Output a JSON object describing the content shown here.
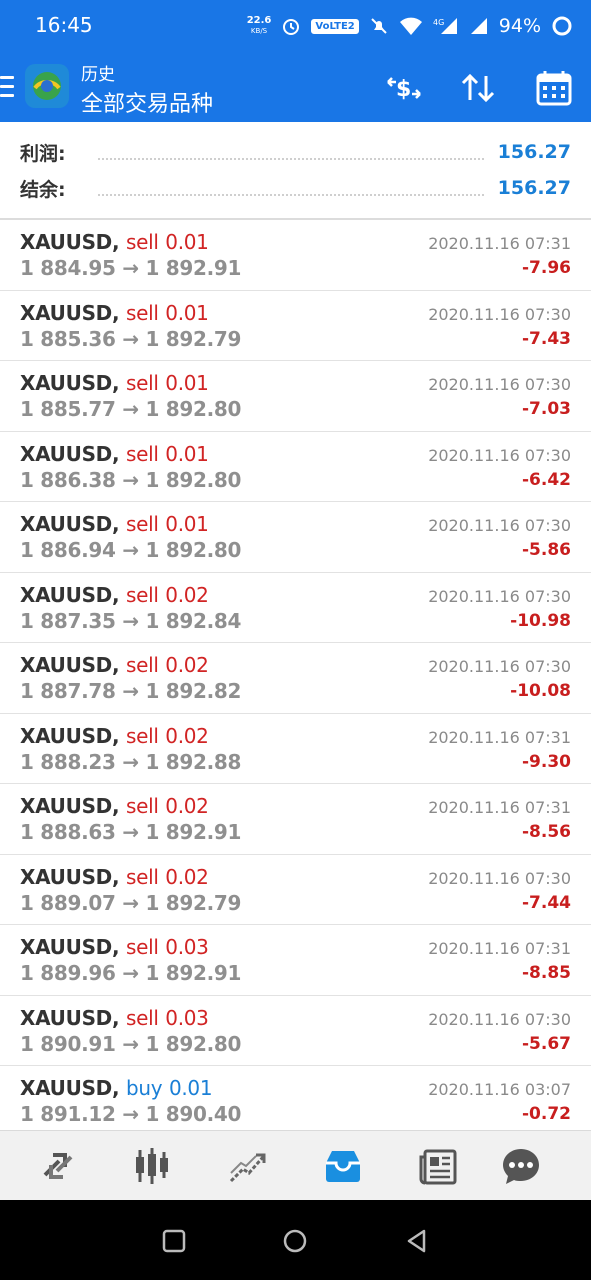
{
  "status_bar": {
    "time": "16:45",
    "net_speed": "22.6",
    "net_unit": "KB/S",
    "volte": "VoLTE2",
    "battery": "94%"
  },
  "toolbar": {
    "subtitle": "历史",
    "title": "全部交易品种"
  },
  "summary": {
    "profit_label": "利润:",
    "profit_value": "156.27",
    "balance_label": "结余:",
    "balance_value": "156.27"
  },
  "trades": [
    {
      "symbol": "XAUUSD,",
      "dir": "sell",
      "lots": "0.01",
      "prices": "1 884.95 → 1 892.91",
      "time": "2020.11.16 07:31",
      "profit": "-7.96"
    },
    {
      "symbol": "XAUUSD,",
      "dir": "sell",
      "lots": "0.01",
      "prices": "1 885.36 → 1 892.79",
      "time": "2020.11.16 07:30",
      "profit": "-7.43"
    },
    {
      "symbol": "XAUUSD,",
      "dir": "sell",
      "lots": "0.01",
      "prices": "1 885.77 → 1 892.80",
      "time": "2020.11.16 07:30",
      "profit": "-7.03"
    },
    {
      "symbol": "XAUUSD,",
      "dir": "sell",
      "lots": "0.01",
      "prices": "1 886.38 → 1 892.80",
      "time": "2020.11.16 07:30",
      "profit": "-6.42"
    },
    {
      "symbol": "XAUUSD,",
      "dir": "sell",
      "lots": "0.01",
      "prices": "1 886.94 → 1 892.80",
      "time": "2020.11.16 07:30",
      "profit": "-5.86"
    },
    {
      "symbol": "XAUUSD,",
      "dir": "sell",
      "lots": "0.02",
      "prices": "1 887.35 → 1 892.84",
      "time": "2020.11.16 07:30",
      "profit": "-10.98"
    },
    {
      "symbol": "XAUUSD,",
      "dir": "sell",
      "lots": "0.02",
      "prices": "1 887.78 → 1 892.82",
      "time": "2020.11.16 07:30",
      "profit": "-10.08"
    },
    {
      "symbol": "XAUUSD,",
      "dir": "sell",
      "lots": "0.02",
      "prices": "1 888.23 → 1 892.88",
      "time": "2020.11.16 07:31",
      "profit": "-9.30"
    },
    {
      "symbol": "XAUUSD,",
      "dir": "sell",
      "lots": "0.02",
      "prices": "1 888.63 → 1 892.91",
      "time": "2020.11.16 07:31",
      "profit": "-8.56"
    },
    {
      "symbol": "XAUUSD,",
      "dir": "sell",
      "lots": "0.02",
      "prices": "1 889.07 → 1 892.79",
      "time": "2020.11.16 07:30",
      "profit": "-7.44"
    },
    {
      "symbol": "XAUUSD,",
      "dir": "sell",
      "lots": "0.03",
      "prices": "1 889.96 → 1 892.91",
      "time": "2020.11.16 07:31",
      "profit": "-8.85"
    },
    {
      "symbol": "XAUUSD,",
      "dir": "sell",
      "lots": "0.03",
      "prices": "1 890.91 → 1 892.80",
      "time": "2020.11.16 07:30",
      "profit": "-5.67"
    },
    {
      "symbol": "XAUUSD,",
      "dir": "buy",
      "lots": "0.01",
      "prices": "1 891.12 → 1 890.40",
      "time": "2020.11.16 03:07",
      "profit": "-0.72"
    }
  ],
  "bottom_nav": [
    {
      "icon": "quotes-icon",
      "active": false
    },
    {
      "icon": "chart-icon",
      "active": false
    },
    {
      "icon": "trade-icon",
      "active": false
    },
    {
      "icon": "history-icon",
      "active": true
    },
    {
      "icon": "news-icon",
      "active": false
    },
    {
      "icon": "chat-icon",
      "active": false
    }
  ],
  "colors": {
    "primary": "#1976e6",
    "sell": "#d12424",
    "buy": "#1a7fd6",
    "loss": "#c81e1e"
  }
}
